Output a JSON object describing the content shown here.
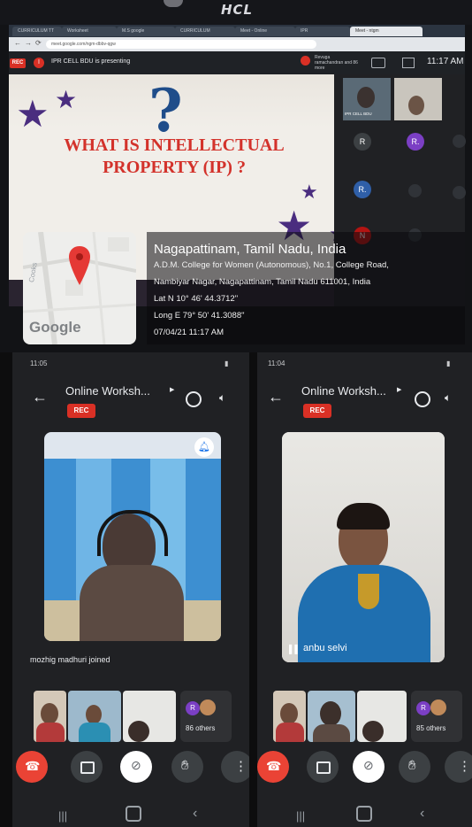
{
  "monitor": {
    "brand": "HCL",
    "browser_tabs": [
      "CURRICULUM TT",
      "Worksheet",
      "M.S google",
      "CURRICULUM",
      "Meet - Online",
      "IPR",
      "Meet - ntgm"
    ],
    "url": "meet.google.com/ngm-dbbv-qgw",
    "meet": {
      "rec_label": "REC",
      "presenter_initial": "I",
      "presenting_text": "IPR CELL BDU is presenting",
      "notification_text": "Revuga ramachandran and 86 more",
      "time": "11:17 AM",
      "participant_initials": [
        "R",
        "R.",
        "R.",
        "N"
      ],
      "tile_label": "IPR CELL BDU"
    },
    "slide": {
      "title_line1": "WHAT IS INTELLECTUAL",
      "title_line2": "PROPERTY (IP) ?",
      "question_mark": "?"
    }
  },
  "location": {
    "map_brand": "Google",
    "road_label": "Cooks",
    "title": "Nagapattinam, Tamil Nadu, India",
    "address_line1": "A.D.M. College for Women (Autonomous), No.1, College Road,",
    "address_line2": "Nambiyar Nagar, Nagapattinam, Tamil Nadu 611001, India",
    "lat": "Lat N 10° 46' 44.3712\"",
    "long": "Long E 79° 50' 41.3088\"",
    "datetime": "07/04/21 11:17 AM"
  },
  "phone_left": {
    "time": "11:05",
    "meeting_title": "Online Worksh...",
    "rec_label": "REC",
    "joined_text": "mozhig madhuri joined",
    "others_label": "86 others",
    "others_initial": "R"
  },
  "phone_right": {
    "time": "11:04",
    "meeting_title": "Online Worksh...",
    "rec_label": "REC",
    "speaker_name": "anbu selvi",
    "others_label": "85 others",
    "others_initial": "R"
  },
  "colors": {
    "rec_red": "#d93025",
    "meet_dark": "#202124",
    "slide_title_red": "#d3322b",
    "star_purple": "#4a2d7f"
  }
}
